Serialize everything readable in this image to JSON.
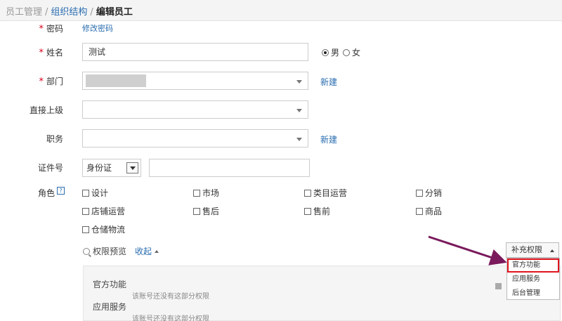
{
  "breadcrumb": {
    "root": "员工管理",
    "parent": "组织结构",
    "current": "编辑员工",
    "sep": "/"
  },
  "form": {
    "required_mark": "*",
    "password": {
      "label": "密码",
      "link": "修改密码"
    },
    "name": {
      "label": "姓名",
      "value": "测试"
    },
    "gender": {
      "male": "男",
      "female": "女",
      "selected": "男"
    },
    "department": {
      "label": "部门",
      "new_link": "新建"
    },
    "supervisor": {
      "label": "直接上级"
    },
    "position": {
      "label": "职务",
      "new_link": "新建"
    },
    "id_number": {
      "label": "证件号",
      "type_selected": "身份证",
      "value": ""
    },
    "roles": {
      "label": "角色",
      "help_icon": "?",
      "options": [
        "设计",
        "市场",
        "类目运营",
        "分销",
        "店铺运营",
        "售后",
        "售前",
        "商品",
        "仓储物流"
      ]
    }
  },
  "permissions": {
    "preview_label": "权限预览",
    "collapse_label": "收起",
    "sections": [
      {
        "title": "官方功能",
        "note": "该账号还没有这部分权限"
      },
      {
        "title": "应用服务",
        "note": "该账号还没有这部分权限"
      }
    ]
  },
  "supplement": {
    "button_label": "补充权限",
    "menu": [
      "官方功能",
      "应用服务",
      "后台管理"
    ],
    "highlighted": "官方功能"
  },
  "colors": {
    "link": "#2a6db0",
    "required": "#d9001b",
    "highlight_box": "#e0151d",
    "annotation_arrow": "#7a1a5c"
  }
}
